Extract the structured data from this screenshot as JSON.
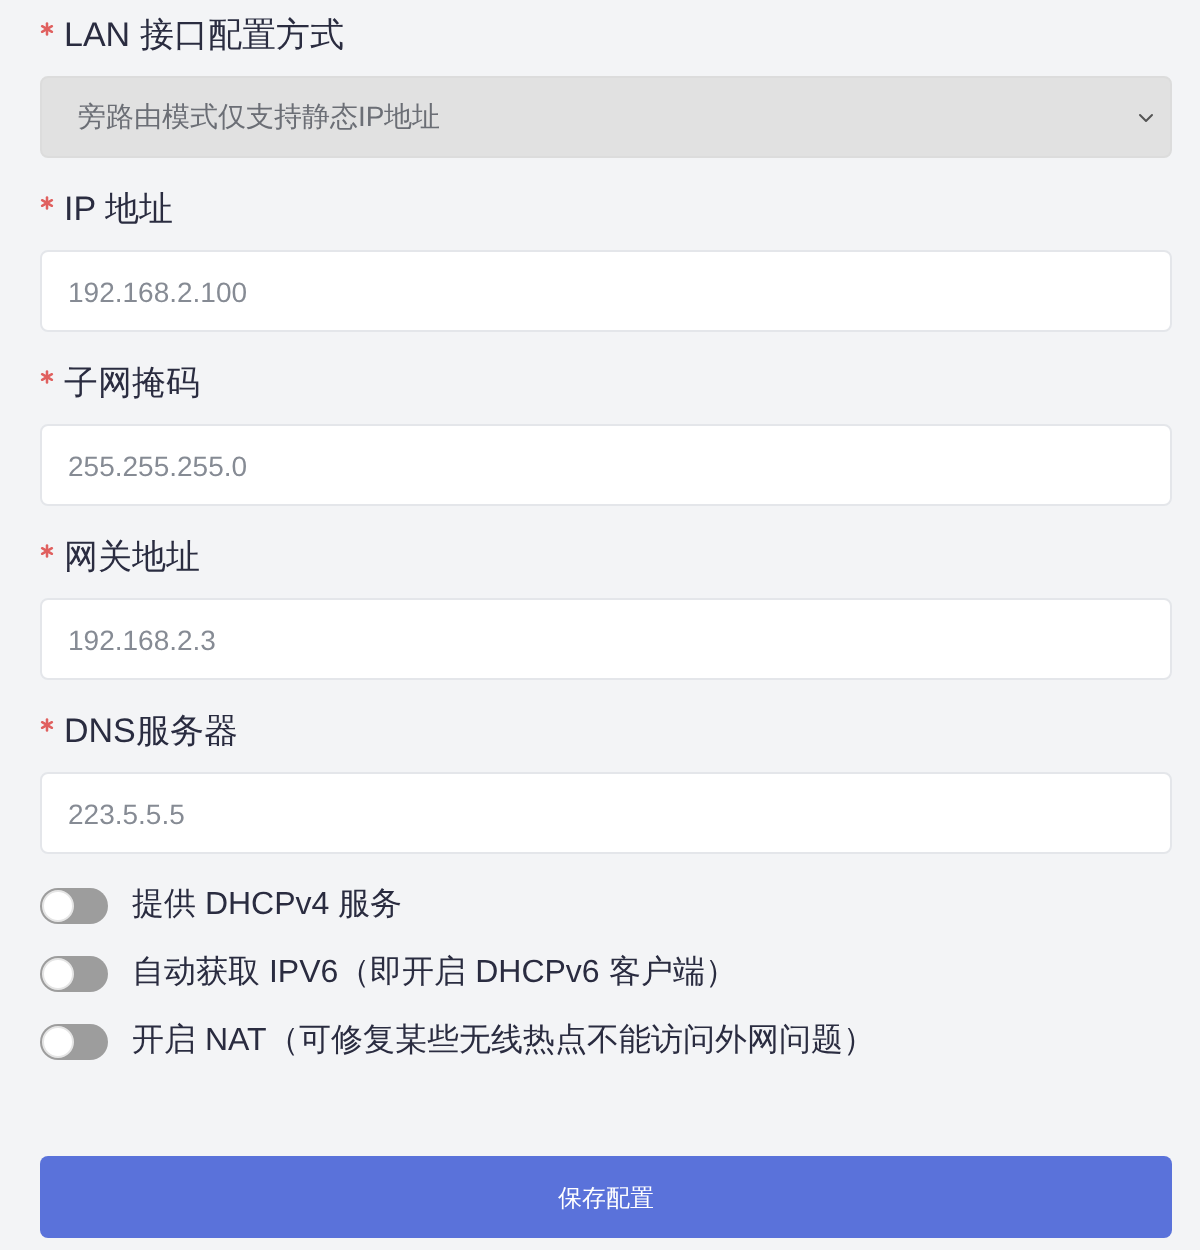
{
  "fields": [
    {
      "kind": "select",
      "label": "LAN 接口配置方式",
      "required": true,
      "disabled": true,
      "value": "旁路由模式仅支持静态IP地址"
    },
    {
      "kind": "input",
      "label": "IP 地址",
      "required": true,
      "disabled": false,
      "value": "192.168.2.100"
    },
    {
      "kind": "input",
      "label": "子网掩码",
      "required": true,
      "disabled": false,
      "value": "255.255.255.0"
    },
    {
      "kind": "input",
      "label": "网关地址",
      "required": true,
      "disabled": false,
      "value": "192.168.2.3"
    },
    {
      "kind": "input",
      "label": "DNS服务器",
      "required": true,
      "disabled": false,
      "value": "223.5.5.5"
    }
  ],
  "switches": [
    {
      "label": "提供 DHCPv4 服务",
      "on": false
    },
    {
      "label": "自动获取 IPV6（即开启 DHCPv6 客户端）",
      "on": false
    },
    {
      "label": "开启 NAT（可修复某些无线热点不能访问外网问题）",
      "on": false
    }
  ],
  "button": {
    "label": "保存配置"
  }
}
